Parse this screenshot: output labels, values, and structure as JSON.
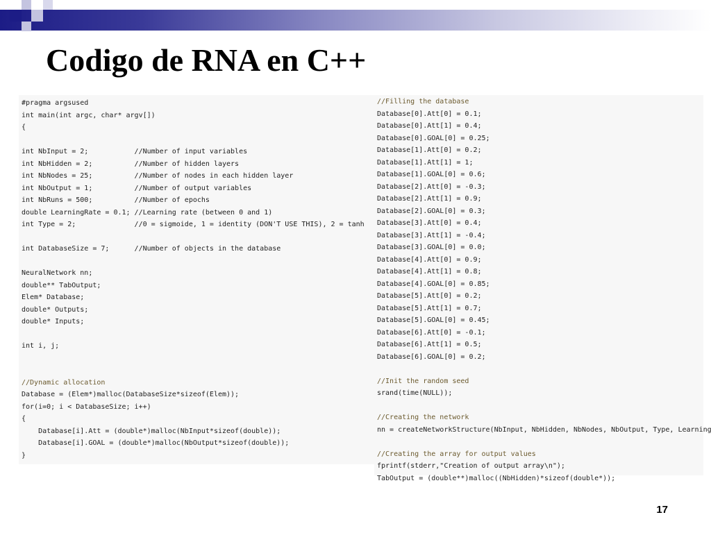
{
  "slide": {
    "title": "Codigo de RNA en C++",
    "page_number": "17"
  },
  "left_code": [
    "#pragma argsused",
    "int main(int argc, char* argv[])",
    "{",
    "",
    "int NbInput = 2;           //Number of input variables",
    "int NbHidden = 2;          //Number of hidden layers",
    "int NbNodes = 25;          //Number of nodes in each hidden layer",
    "int NbOutput = 1;          //Number of output variables",
    "int NbRuns = 500;          //Number of epochs",
    "double LearningRate = 0.1; //Learning rate (between 0 and 1)",
    "int Type = 2;              //0 = sigmoide, 1 = identity (DON'T USE THIS), 2 = tanh",
    "",
    "int DatabaseSize = 7;      //Number of objects in the database",
    "",
    "NeuralNetwork nn;",
    "double** TabOutput;",
    "Elem* Database;",
    "double* Outputs;",
    "double* Inputs;",
    "",
    "int i, j;",
    "",
    "",
    "//Dynamic allocation",
    "Database = (Elem*)malloc(DatabaseSize*sizeof(Elem));",
    "for(i=0; i < DatabaseSize; i++)",
    "{",
    "    Database[i].Att = (double*)malloc(NbInput*sizeof(double));",
    "    Database[i].GOAL = (double*)malloc(NbOutput*sizeof(double));",
    "}"
  ],
  "right_code": [
    "//Filling the database",
    "Database[0].Att[0] = 0.1;",
    "Database[0].Att[1] = 0.4;",
    "Database[0].GOAL[0] = 0.25;",
    "Database[1].Att[0] = 0.2;",
    "Database[1].Att[1] = 1;",
    "Database[1].GOAL[0] = 0.6;",
    "Database[2].Att[0] = -0.3;",
    "Database[2].Att[1] = 0.9;",
    "Database[2].GOAL[0] = 0.3;",
    "Database[3].Att[0] = 0.4;",
    "Database[3].Att[1] = -0.4;",
    "Database[3].GOAL[0] = 0.0;",
    "Database[4].Att[0] = 0.9;",
    "Database[4].Att[1] = 0.8;",
    "Database[4].GOAL[0] = 0.85;",
    "Database[5].Att[0] = 0.2;",
    "Database[5].Att[1] = 0.7;",
    "Database[5].GOAL[0] = 0.45;",
    "Database[6].Att[0] = -0.1;",
    "Database[6].Att[1] = 0.5;",
    "Database[6].GOAL[0] = 0.2;",
    "",
    "//Init the random seed",
    "srand(time(NULL));",
    "",
    "//Creating the network",
    "nn = createNetworkStructure(NbInput, NbHidden, NbNodes, NbOutput, Type, LearningRate);",
    "",
    "//Creating the array for output values",
    "fprintf(stderr,\"Creation of output array\\n\");",
    "TabOutput = (double**)malloc((NbHidden)*sizeof(double*));"
  ],
  "colors": {
    "band_dark": "#1c1c86",
    "code_background": "#f7f7f7",
    "comment": "#7a6a3a"
  }
}
